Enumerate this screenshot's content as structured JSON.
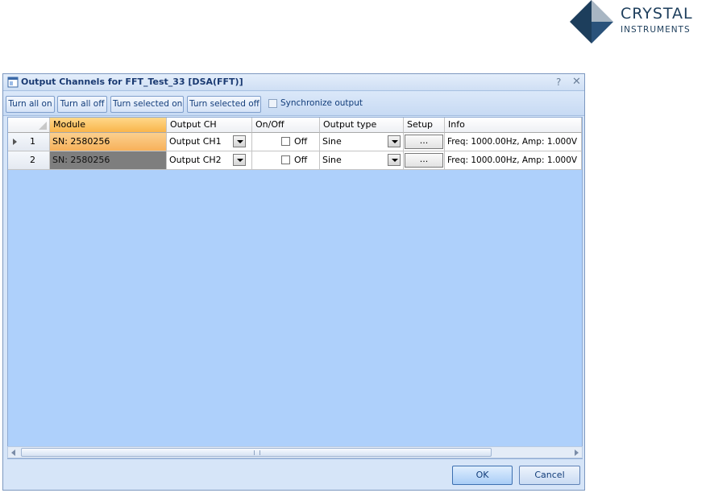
{
  "logo": {
    "line1": "CRYSTAL",
    "line2": "INSTRUMENTS",
    "colors": {
      "dark": "#1d3e5c",
      "light": "#a8b6c3"
    }
  },
  "window": {
    "title": "Output Channels for FFT_Test_33 [DSA(FFT)]",
    "help_label": "?",
    "close_label": "✕",
    "icon": "window-icon"
  },
  "toolbar": {
    "turn_all_on": "Turn all on",
    "turn_all_off": "Turn all off",
    "turn_selected_on": "Turn selected on",
    "turn_selected_off": "Turn selected off",
    "sync_label": "Synchronize output",
    "sync_checked": false
  },
  "table": {
    "columns": {
      "module": "Module",
      "output_ch": "Output CH",
      "on_off": "On/Off",
      "output_type": "Output type",
      "setup": "Setup",
      "info": "Info"
    },
    "rows": [
      {
        "num": "1",
        "module": "SN: 2580256",
        "output_ch": "Output CH1",
        "on_off": "Off",
        "checked": false,
        "output_type": "Sine",
        "setup": "...",
        "info": "Freq: 1000.00Hz, Amp: 1.000V",
        "selected": true
      },
      {
        "num": "2",
        "module": "SN: 2580256",
        "output_ch": "Output CH2",
        "on_off": "Off",
        "checked": false,
        "output_type": "Sine",
        "setup": "...",
        "info": "Freq: 1000.00Hz, Amp: 1.000V",
        "selected": false
      }
    ]
  },
  "footer": {
    "ok": "OK",
    "cancel": "Cancel"
  },
  "colors": {
    "accent": "#f9b54b",
    "grid_background": "#aed0fb",
    "dialog_background": "#d6e5f8"
  }
}
